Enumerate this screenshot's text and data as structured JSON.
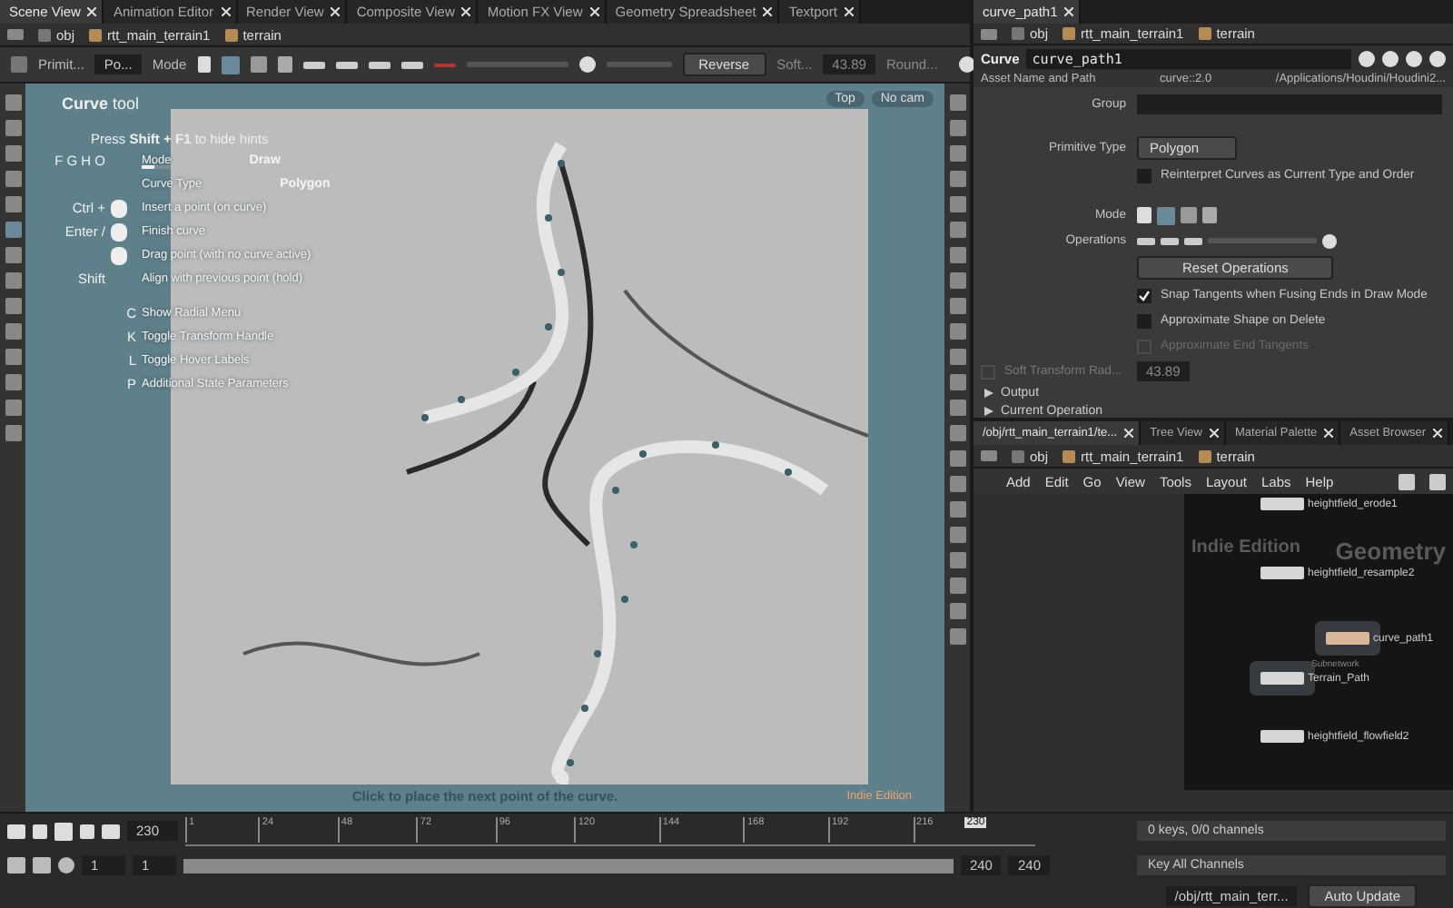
{
  "scene_tabs": [
    {
      "label": "Scene View",
      "selected": true
    },
    {
      "label": "Animation Editor",
      "selected": false
    },
    {
      "label": "Render View",
      "selected": false
    },
    {
      "label": "Composite View",
      "selected": false
    },
    {
      "label": "Motion FX View",
      "selected": false
    },
    {
      "label": "Geometry Spreadsheet",
      "selected": false
    },
    {
      "label": "Textport",
      "selected": false
    }
  ],
  "scene_path": [
    "obj",
    "rtt_main_terrain1",
    "terrain"
  ],
  "scene_toolbar": {
    "primitive_label": "Primit...",
    "primitive_value": "Po...",
    "mode_label": "Mode",
    "reverse": "Reverse",
    "soft": "Soft...",
    "soft_value": "43.89",
    "round": "Round..."
  },
  "viewport": {
    "tool_title": "**Curve** tool",
    "hint": "Press **Shift + F1** to hide hints",
    "mode_keys": "F G H O",
    "mode_rows": [
      {
        "label": "Mode",
        "value": "Draw",
        "level": 0.45
      },
      {
        "label": "Curve Type",
        "value": "Polygon"
      }
    ],
    "mouse_hints": [
      {
        "key": "Ctrl +",
        "text": "Insert a point (on curve)"
      },
      {
        "key": "Enter /",
        "text": "Finish curve"
      },
      {
        "text": "Drag point (with no curve active)"
      },
      {
        "key": "Shift",
        "text": "Align with previous point (hold)"
      }
    ],
    "key_hints": [
      {
        "key": "C",
        "text": "Show Radial Menu"
      },
      {
        "key": "K",
        "text": "Toggle Transform Handle"
      },
      {
        "key": "L",
        "text": "Toggle Hover Labels"
      },
      {
        "key": "P",
        "text": "Additional State Parameters"
      }
    ],
    "view_buttons": [
      "Top",
      "No cam"
    ],
    "status": "Click to place the next point of the curve.",
    "edition": "Indie Edition"
  },
  "params": {
    "tab": "curve_path1",
    "path": [
      "obj",
      "rtt_main_terrain1",
      "terrain"
    ],
    "node_type": "Curve",
    "node_name": "curve_path1",
    "asset_label": "Asset Name and Path",
    "asset_name": "curve::2.0",
    "asset_path": "/Applications/Houdini/Houdini2...",
    "group_label": "Group",
    "primitive_label": "Primitive Type",
    "primitive_value": "Polygon",
    "mode_label": "Mode",
    "operations_label": "Operations",
    "reset": "Reset Operations",
    "checks": [
      {
        "label": "Reinterpret Curves as Current Type and Order",
        "checked": false,
        "disabled": false
      },
      {
        "label": "Snap Tangents when Fusing Ends in Draw Mode",
        "checked": true,
        "disabled": false
      },
      {
        "label": "Approximate Shape on Delete",
        "checked": false,
        "disabled": false
      },
      {
        "label": "Approximate End Tangents",
        "checked": false,
        "disabled": true
      }
    ],
    "soft_label": "Soft Transform Rad...",
    "soft_checked": false,
    "soft_value": "43.89",
    "folders": [
      {
        "label": "Output",
        "expanded": false
      },
      {
        "label": "Current Operation",
        "expanded": false
      }
    ]
  },
  "network": {
    "tabs": [
      {
        "label": "/obj/rtt_main_terrain1/te...",
        "selected": true
      },
      {
        "label": "Tree View",
        "selected": false
      },
      {
        "label": "Material Palette",
        "selected": false
      },
      {
        "label": "Asset Browser",
        "selected": false
      }
    ],
    "path": [
      "obj",
      "rtt_main_terrain1",
      "terrain"
    ],
    "menu": [
      "Add",
      "Edit",
      "Go",
      "View",
      "Tools",
      "Layout",
      "Labs",
      "Help"
    ],
    "watermark": "Indie Edition",
    "context": "Geometry",
    "nodes": [
      {
        "name": "heightfield_erode1",
        "kind": "plain"
      },
      {
        "name": "heightfield_resample2",
        "kind": "plain"
      },
      {
        "name": "curve_path1",
        "kind": "current"
      },
      {
        "name": "Terrain_Path",
        "kind": "subnet",
        "sub": "Subnetwork"
      },
      {
        "name": "heightfield_flowfield2",
        "kind": "plain"
      }
    ]
  },
  "timeline": {
    "frame": "230",
    "ticks": [
      "1",
      "24",
      "48",
      "72",
      "96",
      "120",
      "144",
      "168",
      "192",
      "216"
    ],
    "marker": "230",
    "level": 0.93,
    "start": "1",
    "start2": "1",
    "end": "240",
    "end2": "240",
    "keys": "0 keys, 0/0 channels",
    "key_all": "Key All Channels",
    "status_path": "/obj/rtt_main_terr...",
    "auto_update": "Auto Update"
  }
}
